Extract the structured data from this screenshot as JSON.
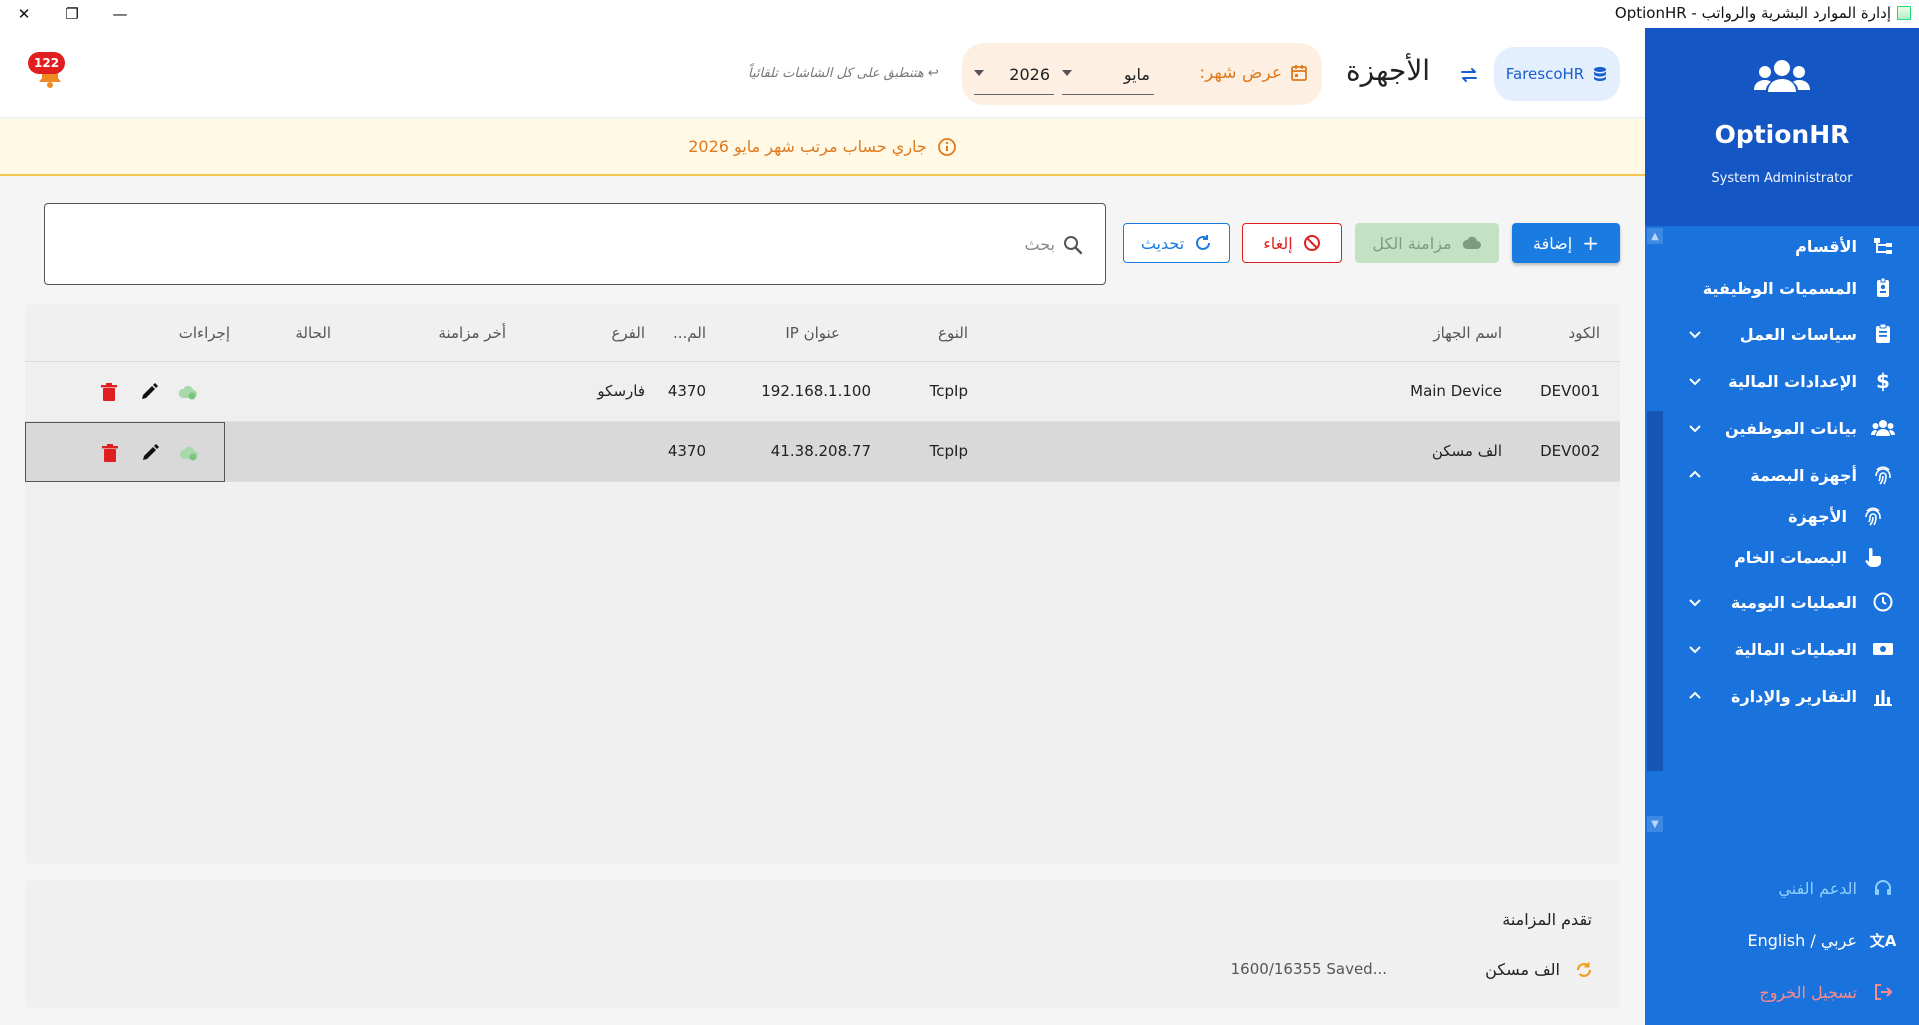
{
  "window": {
    "title": "OptionHR - إدارة الموارد البشرية والرواتب",
    "close_glyph": "✕",
    "restore_glyph": "❐",
    "minimize_glyph": "—"
  },
  "sidebar": {
    "app_name": "OptionHR",
    "role": "System Administrator",
    "items": [
      {
        "label": "الأقسام",
        "icon": "org-chart-icon"
      },
      {
        "label": "المسميات الوظيفية",
        "icon": "id-badge-icon"
      },
      {
        "label": "سياسات العمل",
        "icon": "clipboard-icon",
        "expand": "collapsed"
      },
      {
        "label": "الإعدادات المالية",
        "icon": "dollar-icon",
        "expand": "collapsed"
      },
      {
        "label": "بيانات الموظفين",
        "icon": "people-icon",
        "expand": "collapsed"
      },
      {
        "label": "أجهزة البصمة",
        "icon": "fingerprint-icon",
        "expand": "expanded"
      },
      {
        "label": "الأجهزة",
        "icon": "fingerprint-icon",
        "sub": true
      },
      {
        "label": "البصمات الخام",
        "icon": "touch-icon",
        "sub": true
      },
      {
        "label": "العمليات اليومية",
        "icon": "clock-icon",
        "expand": "collapsed"
      },
      {
        "label": "العمليات المالية",
        "icon": "money-icon",
        "expand": "collapsed"
      },
      {
        "label": "التقارير والإدارة",
        "icon": "bar-chart-icon",
        "expand": "expanded"
      }
    ],
    "support_label": "الدعم الفني",
    "language_label": "عربي / English",
    "logout_label": "تسجيل الخروج",
    "colors": {
      "bg": "#1a72dc",
      "header": "#1457c4",
      "support": "#8fd0ff",
      "logout": "#ff8a8a"
    }
  },
  "header": {
    "notifications_count": "122",
    "hint": "↩ هتنطبق على كل الشاشات تلقائياً",
    "month_label": "عرض شهر:",
    "month_value": "مايو",
    "year_value": "2026",
    "page_title": "الأجهزة",
    "company": "FarescoHR"
  },
  "banner": {
    "text": "جاري حساب مرتب شهر مايو 2026"
  },
  "toolbar": {
    "add_label": "إضافة",
    "sync_all_label": "مزامنة الكل",
    "cancel_label": "إلغاء",
    "refresh_label": "تحديث",
    "search_placeholder": "بحث"
  },
  "table": {
    "columns": {
      "code": "الكود",
      "name": "اسم الجهاز",
      "type": "النوع",
      "ip": "عنوان IP",
      "port": "الم...",
      "branch": "الفرع",
      "last_sync": "أخر مزامنة",
      "status": "الحالة",
      "actions": "إجراءات"
    },
    "rows": [
      {
        "code": "DEV001",
        "name": "Main Device",
        "type": "TcpIp",
        "ip": "192.168.1.100",
        "port": "4370",
        "branch": "فارسكو",
        "last_sync": "",
        "status": ""
      },
      {
        "code": "DEV002",
        "name": "الف مسكن",
        "type": "TcpIp",
        "ip": "41.38.208.77",
        "port": "4370",
        "branch": "",
        "last_sync": "",
        "status": ""
      }
    ]
  },
  "sync_progress": {
    "title": "تقدم المزامنة",
    "device": "الف مسكن",
    "status": "1600/16355 Saved..."
  },
  "colors": {
    "primary": "#1a7be0",
    "accent_orange": "#e07a1f",
    "danger": "#e02020",
    "sync_green": "#c3e2c4"
  }
}
